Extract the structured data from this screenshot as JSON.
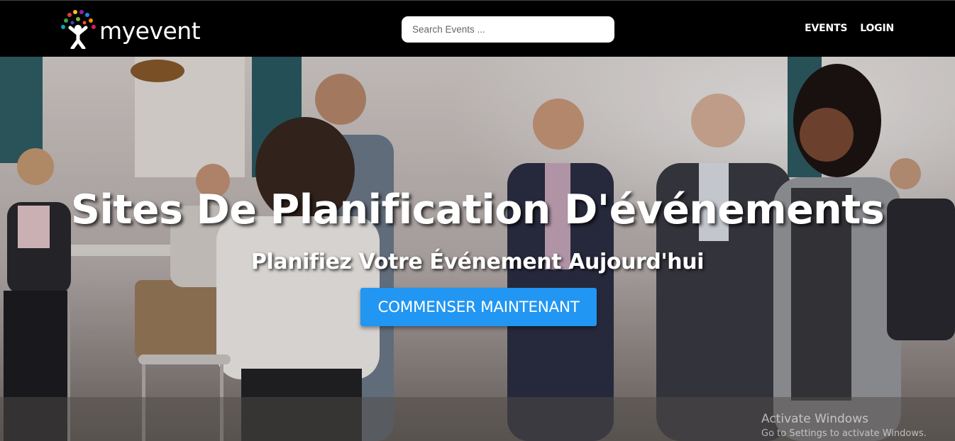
{
  "brand": {
    "name": "myevent",
    "logo_icon": "people-tree-logo"
  },
  "search": {
    "placeholder": "Search Events ..."
  },
  "nav": {
    "items": [
      {
        "label": "EVENTS"
      },
      {
        "label": "LOGIN"
      }
    ]
  },
  "hero": {
    "title": "Sites De Planification D'événements",
    "subtitle": "Planifiez Votre Événement Aujourd'hui",
    "cta_label": "COMMENSER MAINTENANT",
    "background_icon": "networking-event-photo"
  },
  "watermark": {
    "title": "Activate Windows",
    "subtitle": "Go to Settings to activate Windows."
  },
  "colors": {
    "navbar": "#000000",
    "cta": "#2196f3",
    "text": "#ffffff"
  }
}
